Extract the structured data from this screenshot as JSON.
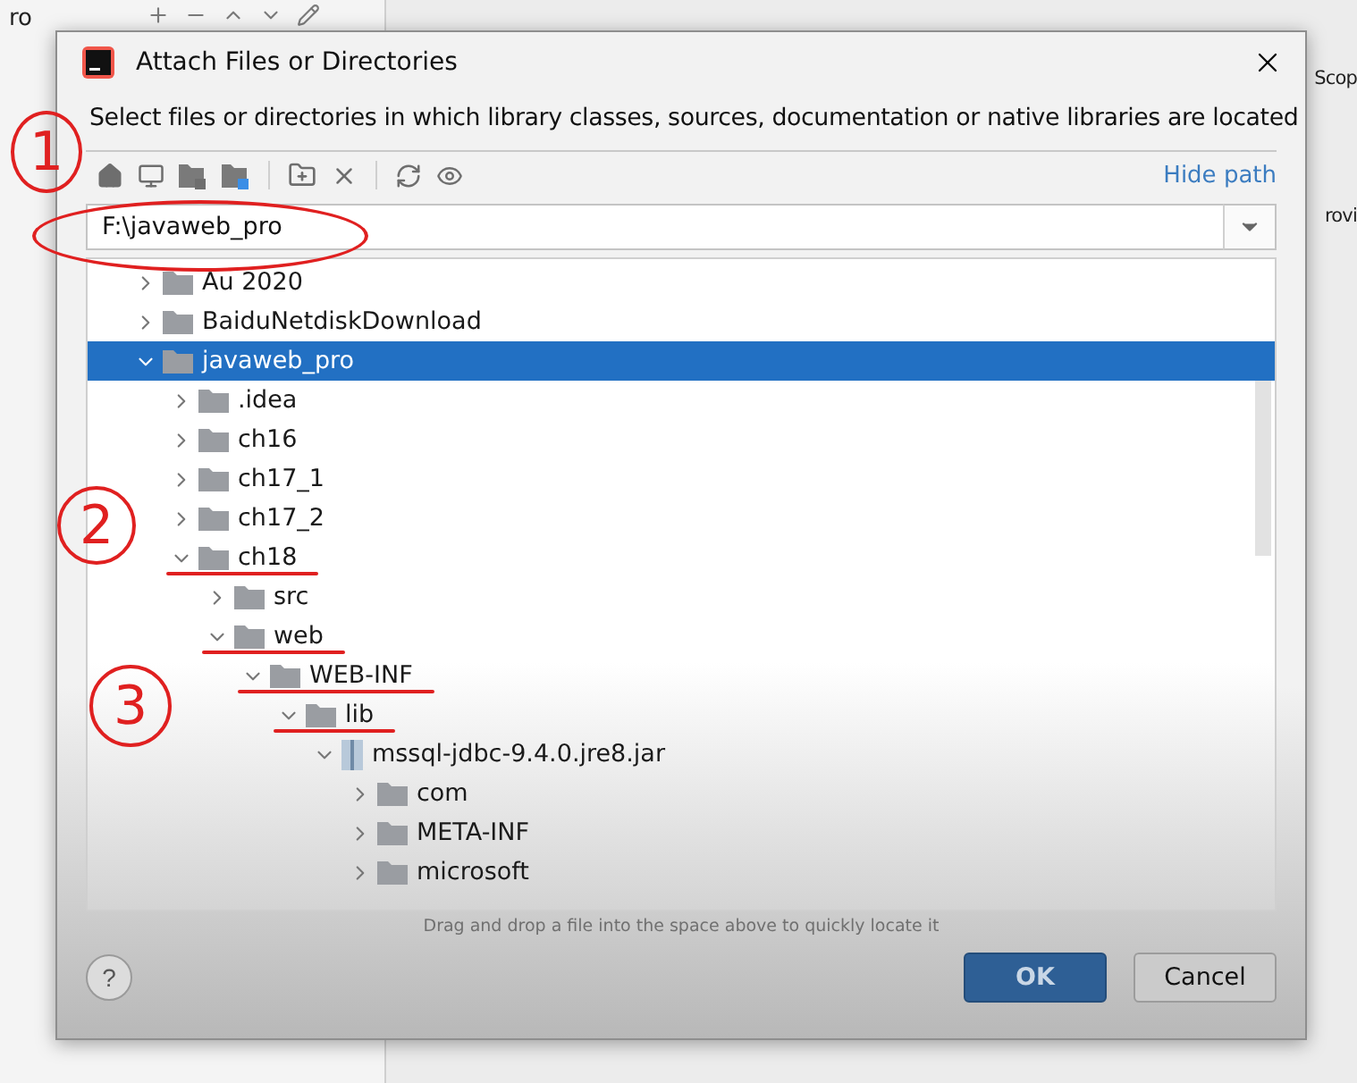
{
  "background": {
    "texts": [
      "ro",
      "Scop",
      "rovi"
    ]
  },
  "dialog": {
    "title": "Attach Files or Directories",
    "description": "Select files or directories in which library classes, sources, documentation or native libraries are located",
    "hide_path_link": "Hide path",
    "path": {
      "value": "F:\\javaweb_pro",
      "circled": true
    },
    "tree": [
      {
        "label": "Au 2020",
        "kind": "folder",
        "expanded": false,
        "selected": false,
        "underlined": false
      },
      {
        "label": "BaiduNetdiskDownload",
        "kind": "folder",
        "expanded": false,
        "selected": false,
        "underlined": false
      },
      {
        "label": "javaweb_pro",
        "kind": "folder",
        "expanded": true,
        "selected": true,
        "underlined": false,
        "children": [
          {
            "label": ".idea",
            "kind": "folder",
            "expanded": false,
            "selected": false,
            "underlined": false
          },
          {
            "label": "ch16",
            "kind": "folder",
            "expanded": false,
            "selected": false,
            "underlined": false
          },
          {
            "label": "ch17_1",
            "kind": "folder",
            "expanded": false,
            "selected": false,
            "underlined": false
          },
          {
            "label": "ch17_2",
            "kind": "folder",
            "expanded": false,
            "selected": false,
            "underlined": false
          },
          {
            "label": "ch18",
            "kind": "folder",
            "expanded": true,
            "selected": false,
            "underlined": true,
            "children": [
              {
                "label": "src",
                "kind": "folder",
                "expanded": false,
                "selected": false,
                "underlined": false
              },
              {
                "label": "web",
                "kind": "folder",
                "expanded": true,
                "selected": false,
                "underlined": true,
                "children": [
                  {
                    "label": "WEB-INF",
                    "kind": "folder",
                    "expanded": true,
                    "selected": false,
                    "underlined": true,
                    "children": [
                      {
                        "label": "lib",
                        "kind": "folder",
                        "expanded": true,
                        "selected": false,
                        "underlined": true,
                        "children": [
                          {
                            "label": "mssql-jdbc-9.4.0.jre8.jar",
                            "kind": "jar",
                            "expanded": true,
                            "selected": false,
                            "underlined": false,
                            "children": [
                              {
                                "label": "com",
                                "kind": "folder",
                                "expanded": false,
                                "selected": false,
                                "underlined": false
                              },
                              {
                                "label": "META-INF",
                                "kind": "folder",
                                "expanded": false,
                                "selected": false,
                                "underlined": false
                              },
                              {
                                "label": "microsoft",
                                "kind": "folder",
                                "expanded": false,
                                "selected": false,
                                "underlined": false
                              }
                            ]
                          }
                        ]
                      }
                    ]
                  }
                ]
              }
            ]
          }
        ]
      }
    ],
    "drag_hint": "Drag and drop a file into the space above to quickly locate it",
    "help": "?",
    "buttons": [
      {
        "label": "OK",
        "kind": "primary"
      },
      {
        "label": "Cancel",
        "kind": "secondary"
      }
    ]
  },
  "annotations": [
    {
      "label": "1"
    },
    {
      "label": "2"
    },
    {
      "label": "3"
    }
  ]
}
